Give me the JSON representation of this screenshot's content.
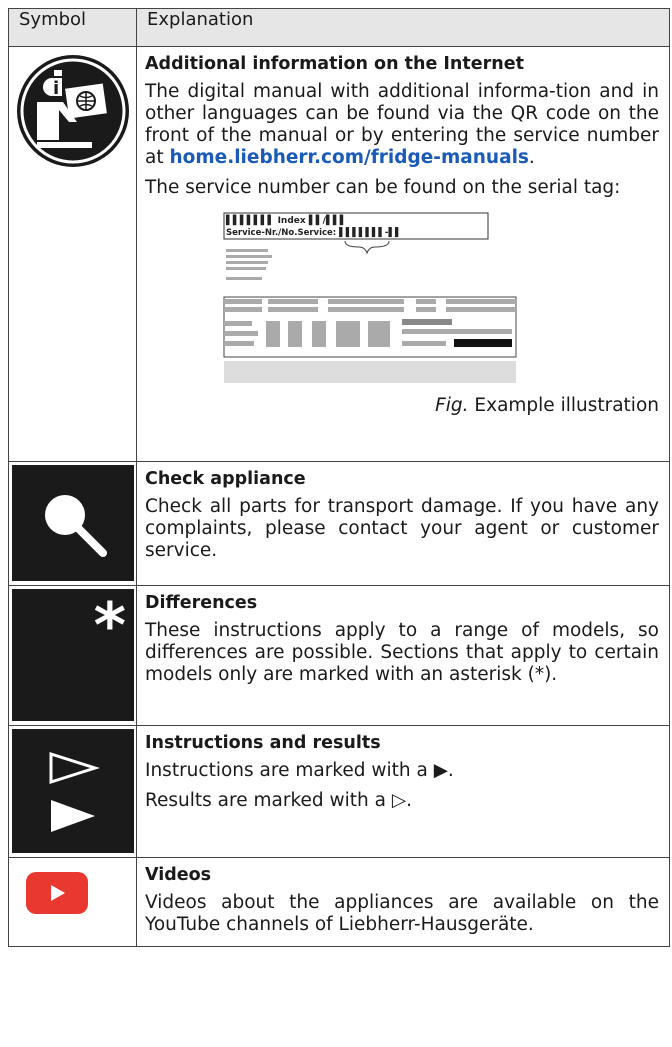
{
  "header": {
    "symbol": "Symbol",
    "explanation": "Explanation"
  },
  "rows": {
    "internet": {
      "title": "Additional information on the Internet",
      "text_before_link": "The digital manual with additional informa-tion and in other languages can be found via the QR code on the front of the manual or by entering the service number at ",
      "link": "home.liebherr.com/fridge-manuals",
      "text_after_link": ".",
      "serial_text": "The service number can be found on the serial tag:",
      "tag_index": "▌▌▌▌▌▌▌  Index  ▌▌/▌▌▌",
      "tag_service": "Service-Nr./No.Service: ▌▌▌▌▌▌▌-▌▌",
      "caption_italic": "Fig.",
      "caption_rest": " Example illustration"
    },
    "check": {
      "title": "Check appliance",
      "text": "Check all parts for transport damage. If you have any complaints, please contact your agent or customer service."
    },
    "differences": {
      "title": "Differences",
      "text": "These instructions apply to a range of models, so differences are possible. Sections that apply to certain models only are marked with an asterisk (*)."
    },
    "instructions": {
      "title": "Instructions and results",
      "line1": "Instructions are marked with a ▶.",
      "line2": "Results are marked with a ▷."
    },
    "videos": {
      "title": "Videos",
      "text": "Videos about the appliances are available on the YouTube channels of Liebherr-Hausgeräte."
    }
  },
  "colors": {
    "link": "#1a5bb8",
    "header_bg": "#e6e6e6",
    "icon_bg": "#1a1a1a",
    "youtube": "#e8382f"
  }
}
